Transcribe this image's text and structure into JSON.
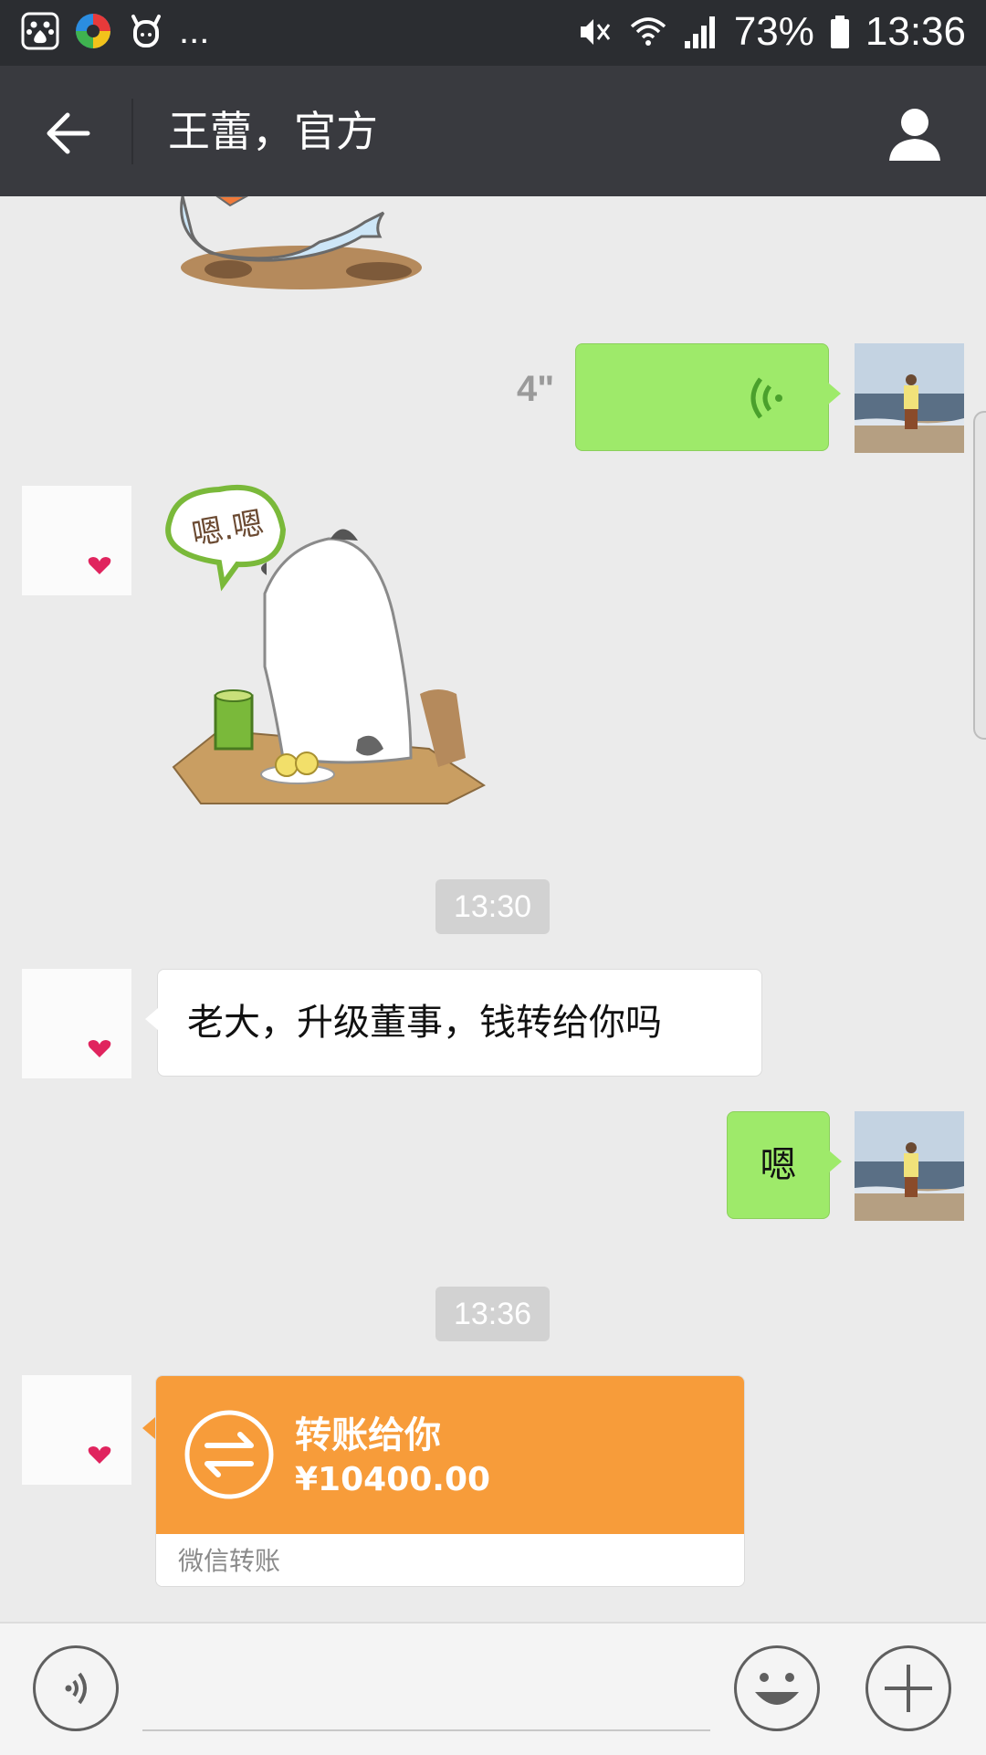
{
  "status_bar": {
    "left_icons": [
      "baidu-icon",
      "color-wheel-icon",
      "cow-icon"
    ],
    "more": "...",
    "battery": "73%",
    "time": "13:36"
  },
  "header": {
    "title": "王蕾，官方",
    "back_icon": "arrow-left-icon",
    "profile_icon": "person-icon"
  },
  "messages": {
    "voice": {
      "duration": "4\""
    },
    "timestamp_1": "13:30",
    "text_in": "老大，升级董事，钱转给你吗",
    "text_out": "嗯",
    "timestamp_2": "13:36",
    "transfer": {
      "title": "转账给你",
      "amount": "¥10400.00",
      "footer": "微信转账"
    }
  },
  "sticker_2_text": "嗯.嗯",
  "colors": {
    "green_bubble": "#9eea6a",
    "transfer_orange": "#f79c3a",
    "titlebar": "#393a3f"
  }
}
